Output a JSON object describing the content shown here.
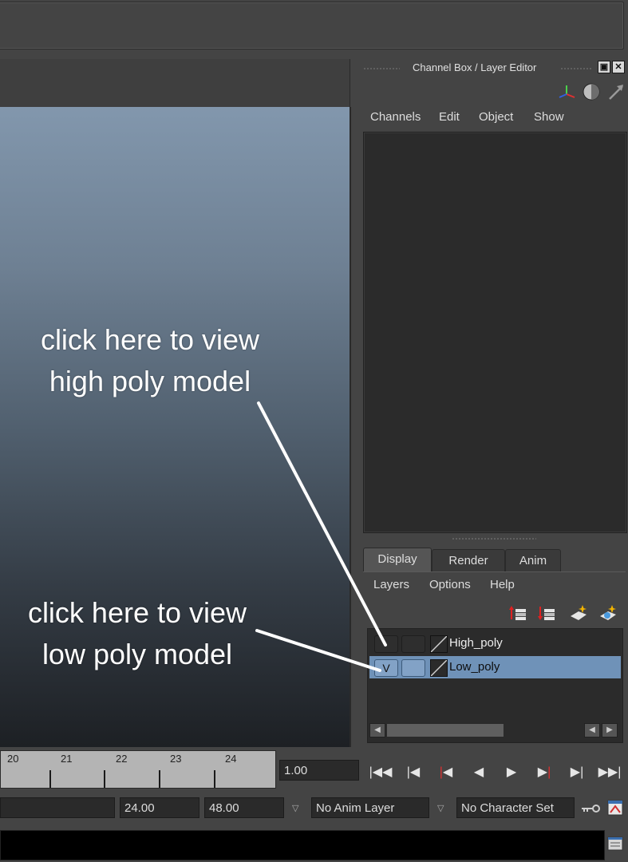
{
  "panel": {
    "title": "Channel Box / Layer Editor",
    "menu": [
      "Channels",
      "Edit",
      "Object",
      "Show"
    ]
  },
  "layer_editor": {
    "tabs": [
      "Display",
      "Render",
      "Anim"
    ],
    "active_tab": "Display",
    "menu": [
      "Layers",
      "Options",
      "Help"
    ],
    "layers": [
      {
        "name": "High_poly",
        "visible": "",
        "selected": false
      },
      {
        "name": "Low_poly",
        "visible": "V",
        "selected": true
      }
    ],
    "toolbar_icons": [
      "move-layer-up-icon",
      "move-layer-down-icon",
      "create-empty-layer-icon",
      "create-layer-from-selected-icon"
    ]
  },
  "timeline": {
    "frames": [
      "20",
      "21",
      "22",
      "23",
      "24"
    ],
    "current_frame": "1.00"
  },
  "playback": {
    "icons": [
      "go-to-start-icon",
      "step-back-frame-icon",
      "step-back-key-icon",
      "play-backwards-icon",
      "play-forwards-icon",
      "step-forward-key-icon",
      "step-forward-frame-icon",
      "go-to-end-icon"
    ]
  },
  "range": {
    "end_time": "24.00",
    "anim_end": "48.00",
    "anim_layer": "No Anim Layer",
    "character_set": "No Character Set"
  },
  "annotations": {
    "high_line1": "click here to view",
    "high_line2": "high poly model",
    "low_line1": "click here to view",
    "low_line2": "low poly model"
  },
  "colors": {
    "selected_row": "#6f92b8",
    "viewport_top": "#8297ad",
    "viewport_bottom": "#1d2024"
  }
}
